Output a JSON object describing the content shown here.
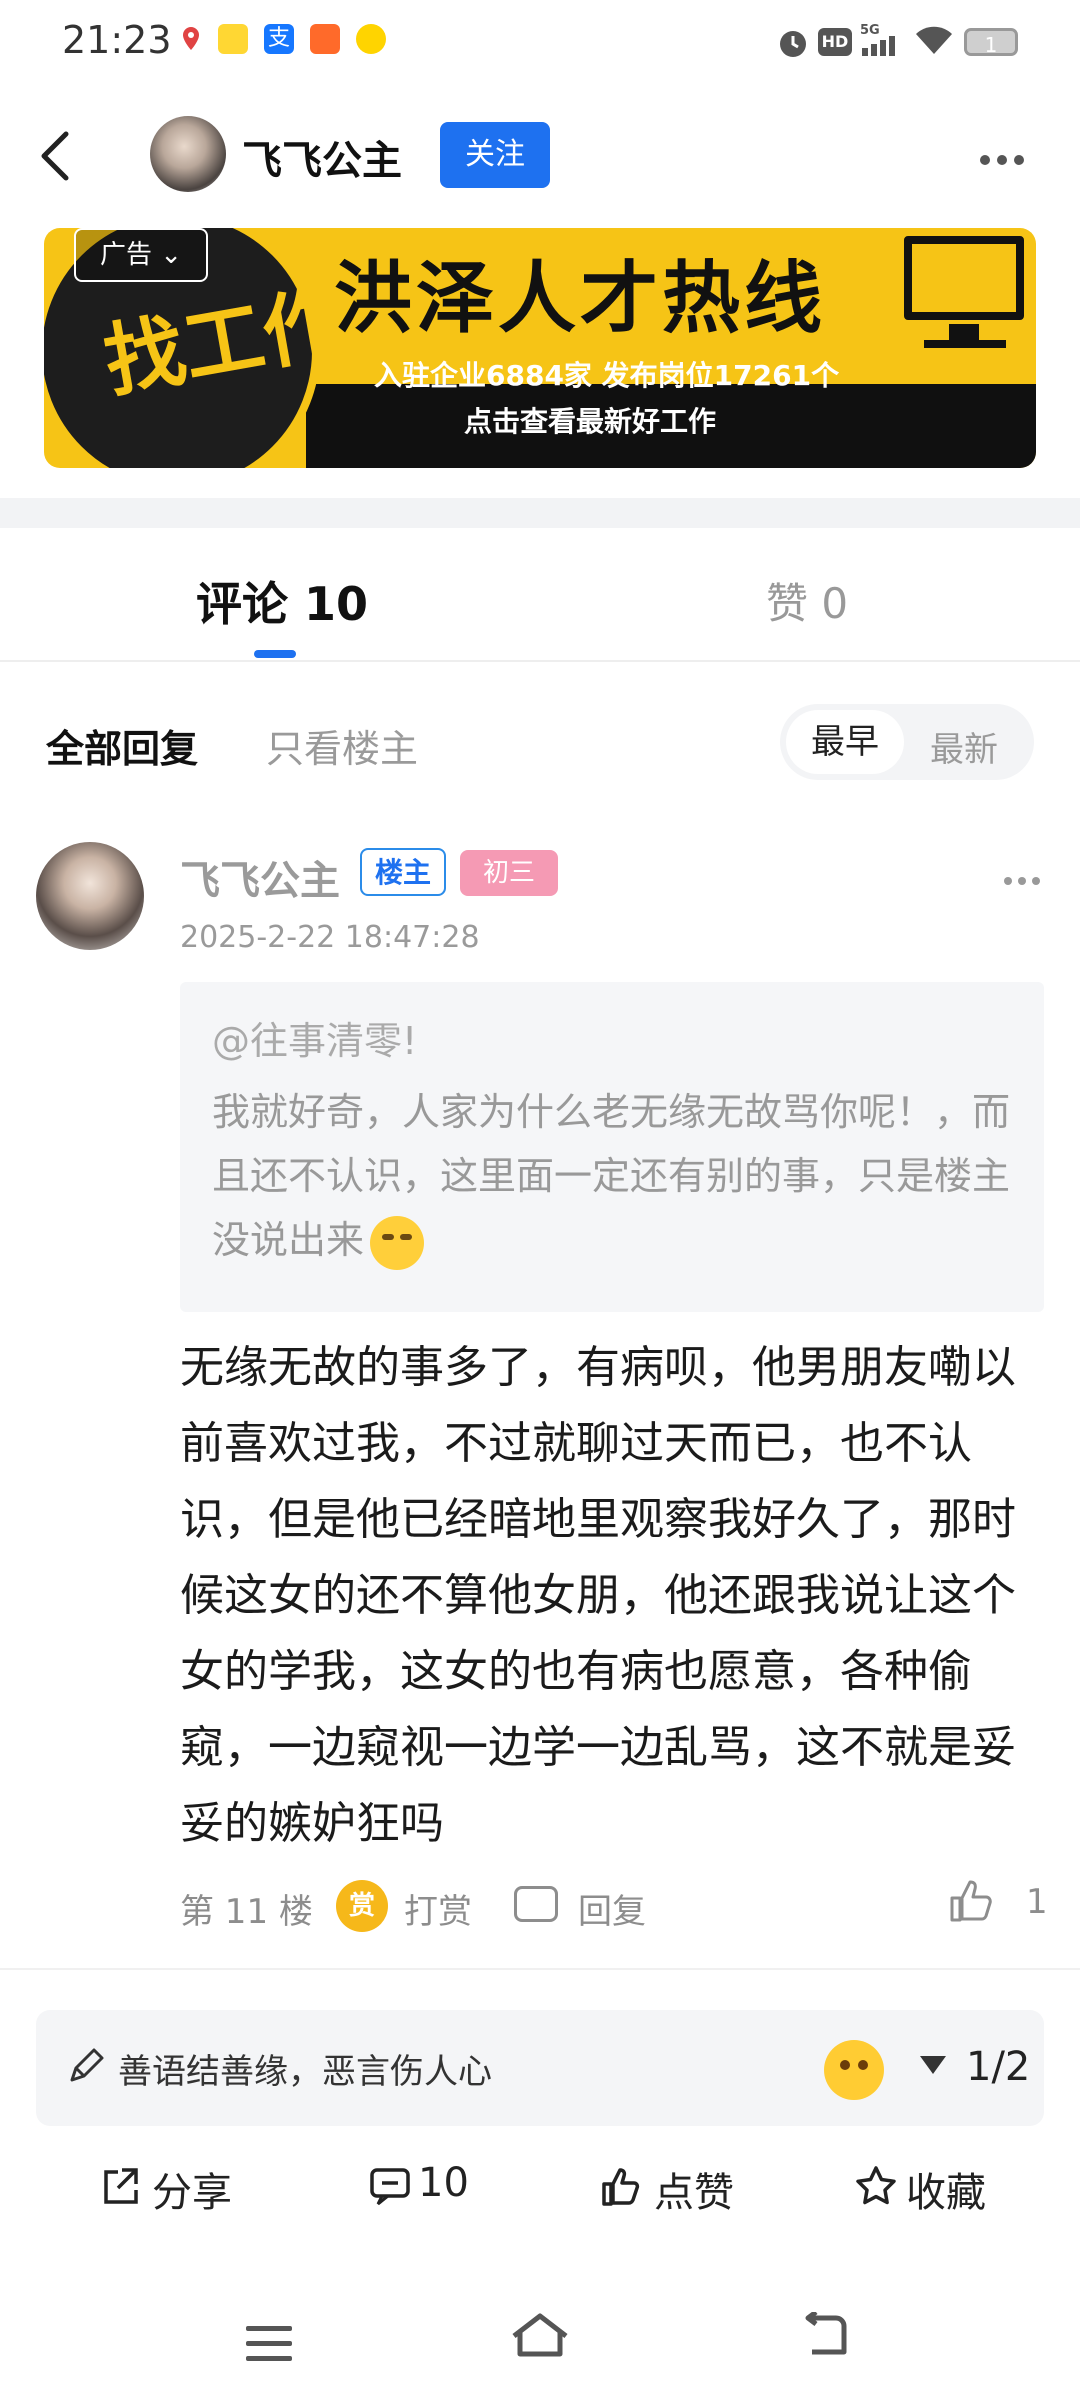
{
  "status_bar": {
    "time": "21:23",
    "battery": "1",
    "signal": "5G"
  },
  "header": {
    "author": "飞飞公主",
    "follow_label": "关注"
  },
  "ad": {
    "tag": "广告",
    "circle_text": "找工作",
    "title": "洪泽人才热线",
    "line1": "入驻企业6884家  发布岗位17261个",
    "line2": "点击查看最新好工作"
  },
  "tabs": {
    "comments": "评论 10",
    "likes": "赞 0"
  },
  "filter": {
    "all": "全部回复",
    "op_only": "只看楼主",
    "sort_earliest": "最早",
    "sort_newest": "最新"
  },
  "comment": {
    "author": "飞飞公主",
    "owner_badge": "楼主",
    "level_badge": "初三",
    "time": "2025-2-22 18:47:28",
    "quote_user": "@往事清零!",
    "quote_text": "我就好奇，人家为什么老无缘无故骂你呢！，而且还不认识，这里面一定还有别的事，只是楼主没说出来",
    "body": "无缘无故的事多了，有病呗，他男朋友嘞以前喜欢过我，不过就聊过天而已，也不认识，但是他已经暗地里观察我好久了，那时候这女的还不算他女朋，他还跟我说让这个女的学我，这女的也有病也愿意，各种偷窥，一边窥视一边学一边乱骂，这不就是妥妥的嫉妒狂吗",
    "floor": "第 11 楼",
    "reward_coin": "赏",
    "reward": "打赏",
    "reply": "回复",
    "likes": "1"
  },
  "input": {
    "placeholder": "善语结善缘，恶言伤人心",
    "page": "1/2"
  },
  "bottom_bar": {
    "share": "分享",
    "comments": "10",
    "like": "点赞",
    "favorite": "收藏"
  },
  "colors": {
    "accent": "#1e71f0",
    "ad_yellow": "#f6c416",
    "level_pink": "#f59ab4"
  }
}
